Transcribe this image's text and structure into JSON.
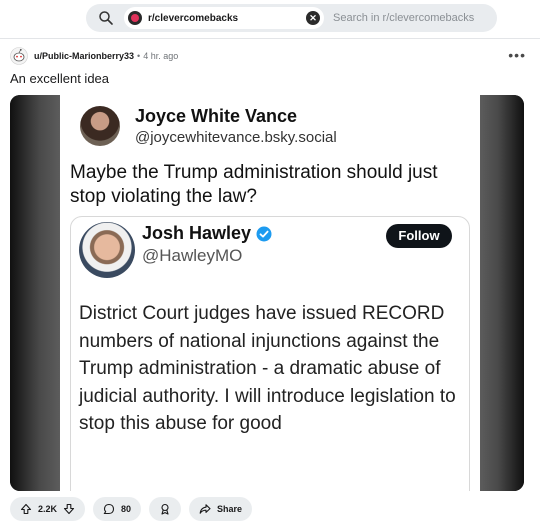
{
  "search": {
    "chip_label": "r/clevercomebacks",
    "placeholder": "Search in r/clevercomebacks"
  },
  "post": {
    "username": "u/Public-Marionberry33",
    "separator": "•",
    "time": "4 hr. ago",
    "more": "•••",
    "title": "An excellent idea"
  },
  "tweet": {
    "name": "Joyce White Vance",
    "handle": "@joycewhitevance.bsky.social",
    "text": "Maybe the Trump administration should just stop violating the law?"
  },
  "quoted_tweet": {
    "name": "Josh Hawley",
    "handle": "@HawleyMO",
    "follow_label": "Follow",
    "text": "District Court judges have issued RECORD numbers of national injunctions against the Trump administration - a dramatic abuse of judicial authority. I will introduce legislation to stop this abuse for good"
  },
  "actions": {
    "votes": "2.2K",
    "comments": "80",
    "share": "Share"
  },
  "colors": {
    "search_bg": "#e9ecef",
    "pill_bg": "#eaedef",
    "verified_blue": "#1d9bf0",
    "follow_bg": "#0f1419"
  },
  "icons": [
    "search-icon",
    "close-icon",
    "snoo-avatar-icon",
    "more-icon",
    "verified-icon",
    "upvote-icon",
    "downvote-icon",
    "comment-icon",
    "award-icon",
    "share-icon"
  ]
}
